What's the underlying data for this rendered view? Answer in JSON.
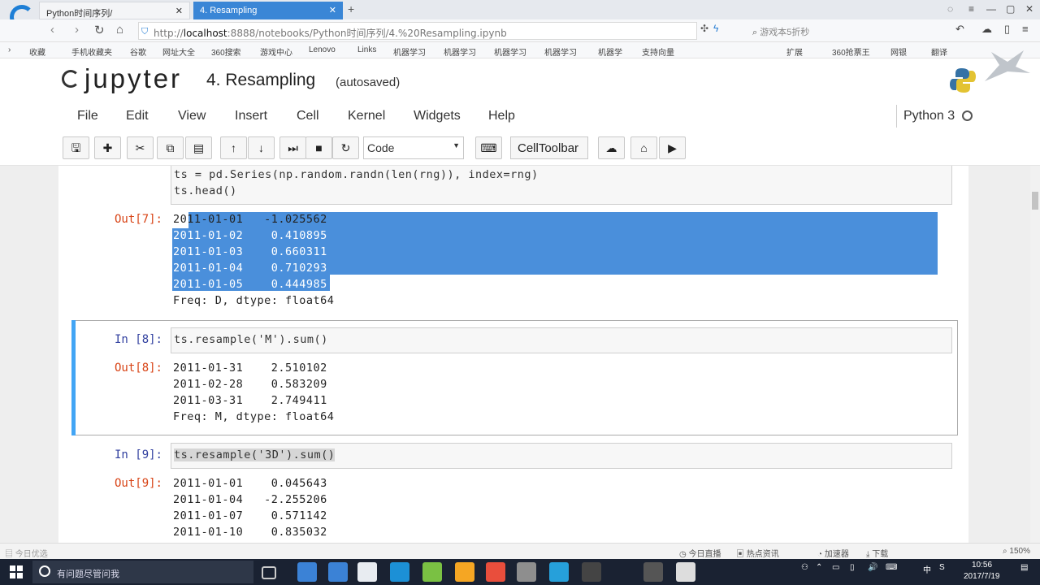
{
  "browser": {
    "tabs": [
      {
        "label": "Python时间序列/"
      },
      {
        "label": "4. Resampling"
      }
    ],
    "new_tab": "+",
    "url_prefix": "http://",
    "url_host": "localhost",
    "url_rest": ":8888/notebooks/Python时间序列/4.%20Resampling.ipynb",
    "search_placeholder": "游戏本5折秒",
    "bookmarks": [
      "收藏",
      "手机收藏夹",
      "谷歌",
      "网址大全",
      "360搜索",
      "游戏中心",
      "Lenovo",
      "Links",
      "机器学习",
      "机器学习",
      "机器学习",
      "机器学习",
      "机器学",
      "支持向量"
    ],
    "right_tools": [
      "扩展",
      "360抢票王",
      "网银",
      "翻译"
    ]
  },
  "jupyter": {
    "logo_text": "jupyter",
    "notebook_title": "4. Resampling",
    "save_status": "(autosaved)",
    "menu": [
      "File",
      "Edit",
      "View",
      "Insert",
      "Cell",
      "Kernel",
      "Widgets",
      "Help"
    ],
    "kernel_name": "Python 3",
    "cell_type": "Code",
    "celltoolbar_label": "CellToolbar"
  },
  "cells": {
    "c7": {
      "code_lines": [
        "ts = pd.Series(np.random.randn(len(rng)), index=rng)",
        "ts.head()"
      ],
      "out_prompt": "Out[7]:",
      "output_lines": [
        "2011-01-01   -1.025562",
        "2011-01-02    0.410895",
        "2011-01-03    0.660311",
        "2011-01-04    0.710293",
        "2011-01-05    0.444985",
        "Freq: D, dtype: float64"
      ]
    },
    "c8": {
      "in_prompt": "In [8]:",
      "code": "ts.resample('M').sum()",
      "out_prompt": "Out[8]:",
      "output_lines": [
        "2011-01-31    2.510102",
        "2011-02-28    0.583209",
        "2011-03-31    2.749411",
        "Freq: M, dtype: float64"
      ]
    },
    "c9": {
      "in_prompt": "In [9]:",
      "code": "ts.resample('3D').sum()",
      "out_prompt": "Out[9]:",
      "output_lines": [
        "2011-01-01    0.045643",
        "2011-01-04   -2.255206",
        "2011-01-07    0.571142",
        "2011-01-10    0.835032"
      ]
    }
  },
  "statusbar": {
    "left": "今日优选",
    "items": [
      "今日直播",
      "热点资讯",
      "加速器",
      "下载"
    ],
    "zoom": "150%"
  },
  "taskbar": {
    "search_text": "有问题尽管问我",
    "time": "10:56",
    "date": "2017/7/19",
    "ime": "中"
  }
}
